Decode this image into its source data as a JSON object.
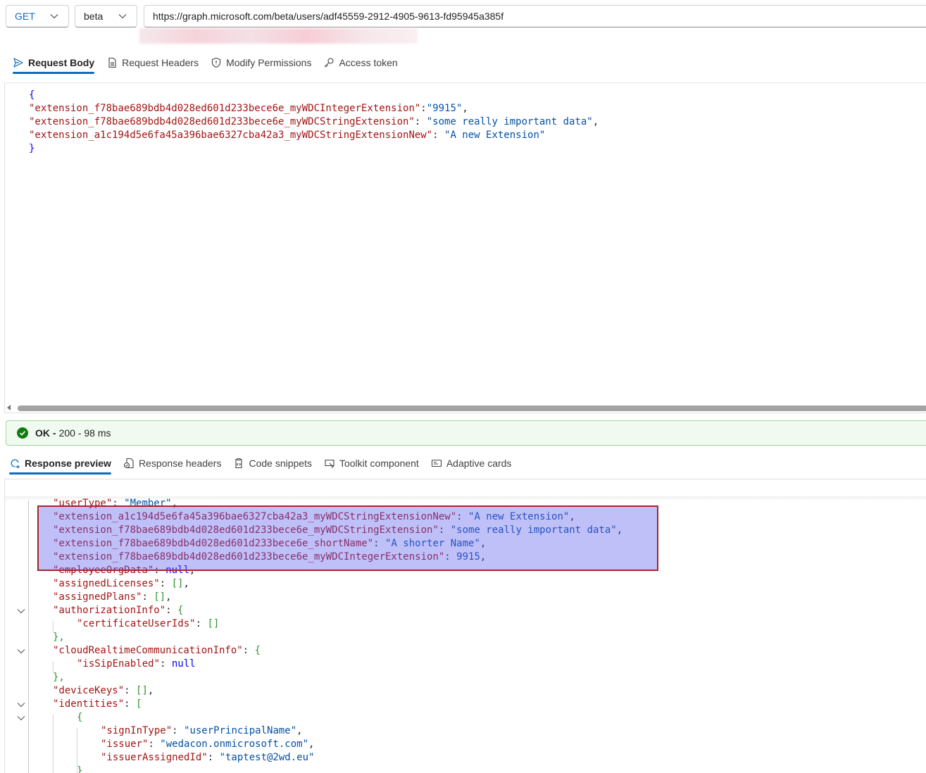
{
  "request_bar": {
    "method": "GET",
    "version": "beta",
    "url": "https://graph.microsoft.com/beta/users/adf45559-2912-4905-9613-fd95945a385f"
  },
  "request_tabs": [
    {
      "label": "Request Body",
      "icon": "send-icon",
      "active": true
    },
    {
      "label": "Request Headers",
      "icon": "document-icon",
      "active": false
    },
    {
      "label": "Modify Permissions",
      "icon": "shield-icon",
      "active": false
    },
    {
      "label": "Access token",
      "icon": "key-icon",
      "active": false
    }
  ],
  "request_body": {
    "open": "{",
    "close": "}",
    "entries": [
      {
        "key": "\"extension_f78bae689bdb4d028ed601d233bece6e_myWDCIntegerExtension\"",
        "sep": ":",
        "value": "\"9915\"",
        "trail": ","
      },
      {
        "key": "\"extension_f78bae689bdb4d028ed601d233bece6e_myWDCStringExtension\"",
        "sep": ": ",
        "value": "\"some really important data\"",
        "trail": ","
      },
      {
        "key": "\"extension_a1c194d5e6fa45a396bae6327cba42a3_myWDCStringExtensionNew\"",
        "sep": ": ",
        "value": "\"A new Extension\"",
        "trail": ""
      }
    ]
  },
  "status": {
    "ok": "OK -",
    "detail": "200 - 98 ms",
    "color": "#107c10"
  },
  "response_tabs": [
    {
      "label": "Response preview",
      "icon": "preview-icon",
      "active": true
    },
    {
      "label": "Response headers",
      "icon": "headers-icon",
      "active": false
    },
    {
      "label": "Code snippets",
      "icon": "clipboard-icon",
      "active": false
    },
    {
      "label": "Toolkit component",
      "icon": "toolkit-icon",
      "active": false
    },
    {
      "label": "Adaptive cards",
      "icon": "card-icon",
      "active": false
    }
  ],
  "response_lines": [
    {
      "k": "\"userType\"",
      "sep": ": ",
      "v": "\"Member\"",
      "t": ","
    },
    {
      "k": "\"extension_a1c194d5e6fa45a396bae6327cba42a3_myWDCStringExtensionNew\"",
      "sep": ": ",
      "v": "\"A new Extension\"",
      "t": ","
    },
    {
      "k": "\"extension_f78bae689bdb4d028ed601d233bece6e_myWDCStringExtension\"",
      "sep": ": ",
      "v": "\"some really important data\"",
      "t": ","
    },
    {
      "k": "\"extension_f78bae689bdb4d028ed601d233bece6e_shortName\"",
      "sep": ": ",
      "v": "\"A shorter Name\"",
      "t": ","
    },
    {
      "k": "\"extension_f78bae689bdb4d028ed601d233bece6e_myWDCIntegerExtension\"",
      "sep": ": ",
      "v": "9915",
      "t": ","
    },
    {
      "k": "\"employeeOrgData\"",
      "sep": ": ",
      "v": "null",
      "t": ","
    },
    {
      "k": "\"assignedLicenses\"",
      "sep": ": ",
      "v": "[]",
      "t": ","
    },
    {
      "k": "\"assignedPlans\"",
      "sep": ": ",
      "v": "[]",
      "t": ","
    },
    {
      "k": "\"authorizationInfo\"",
      "sep": ": ",
      "v": "{",
      "t": ""
    },
    {
      "k": "\"certificateUserIds\"",
      "sep": ": ",
      "v": "[]",
      "t": ""
    },
    {
      "k": "",
      "sep": "",
      "v": "},",
      "t": ""
    },
    {
      "k": "\"cloudRealtimeCommunicationInfo\"",
      "sep": ": ",
      "v": "{",
      "t": ""
    },
    {
      "k": "\"isSipEnabled\"",
      "sep": ": ",
      "v": "null",
      "t": ""
    },
    {
      "k": "",
      "sep": "",
      "v": "},",
      "t": ""
    },
    {
      "k": "\"deviceKeys\"",
      "sep": ": ",
      "v": "[]",
      "t": ","
    },
    {
      "k": "\"identities\"",
      "sep": ": ",
      "v": "[",
      "t": ""
    },
    {
      "k": "",
      "sep": "",
      "v": "{",
      "t": ""
    },
    {
      "k": "\"signInType\"",
      "sep": ": ",
      "v": "\"userPrincipalName\"",
      "t": ","
    },
    {
      "k": "\"issuer\"",
      "sep": ": ",
      "v": "\"wedacon.onmicrosoft.com\"",
      "t": ","
    },
    {
      "k": "\"issuerAssignedId\"",
      "sep": ": ",
      "v": "\"taptest@2wd.eu\"",
      "t": ""
    },
    {
      "k": "",
      "sep": "",
      "v": "}",
      "t": ""
    }
  ]
}
